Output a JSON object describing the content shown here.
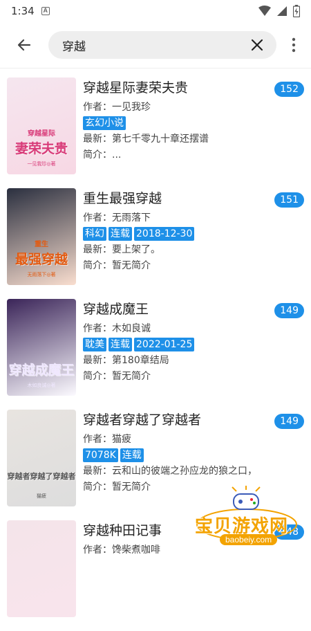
{
  "status": {
    "time": "1:34",
    "notif_icon": "a-badge-icon"
  },
  "search": {
    "query": "穿越"
  },
  "books": [
    {
      "title": "穿越星际妻荣夫贵",
      "author": "作者：一见我珍",
      "tags": [
        "玄幻小说"
      ],
      "latest": "最新：第七千零九十章还摆谱",
      "intro": "简介：...",
      "count": "152",
      "cover": {
        "title": "妻荣夫贵",
        "sub": "穿越星际",
        "author": "一见我珍◎著",
        "bg": "#f5e6ef",
        "accent": "#d83a78"
      }
    },
    {
      "title": "重生最强穿越",
      "author": "作者：无雨落下",
      "tags": [
        "科幻",
        "连载",
        "2018-12-30"
      ],
      "latest": "最新：要上架了。",
      "intro": "简介：暂无简介",
      "count": "151",
      "cover": {
        "title": "最强穿越",
        "sub": "重生",
        "author": "无雨落下◎著",
        "bg": "#2a2f3f",
        "accent": "#e35a10"
      }
    },
    {
      "title": "穿越成魔王",
      "author": "作者：木如良诚",
      "tags": [
        "耽美",
        "连载",
        "2022-01-25"
      ],
      "latest": "最新：第180章结局",
      "intro": "简介：暂无简介",
      "count": "149",
      "cover": {
        "title": "穿越成魔王",
        "sub": "",
        "author": "木如良诚◎著",
        "bg": "#3a2458",
        "accent": "#f0e8ff"
      }
    },
    {
      "title": "穿越者穿越了穿越者",
      "author": "作者：猫疲",
      "tags": [
        "7078K",
        "连载"
      ],
      "latest": "最新：云和山的彼端之孙应龙的狼之口，",
      "intro": "简介：暂无简介",
      "count": "149",
      "cover": {
        "title": "穿越者穿越了穿越者",
        "sub": "",
        "author": "猫疲",
        "bg": "#e8e4e0",
        "accent": "#555555"
      }
    },
    {
      "title": "穿越种田记事",
      "author": "作者：馋柴煮咖啡",
      "tags": [],
      "latest": "",
      "intro": "",
      "count": "148",
      "cover": {
        "title": "",
        "sub": "",
        "author": "",
        "bg": "#f4e4ea",
        "accent": "#e07aa0"
      }
    }
  ],
  "watermark": {
    "text": "宝贝游戏网",
    "sub": "baobeiy.com"
  }
}
